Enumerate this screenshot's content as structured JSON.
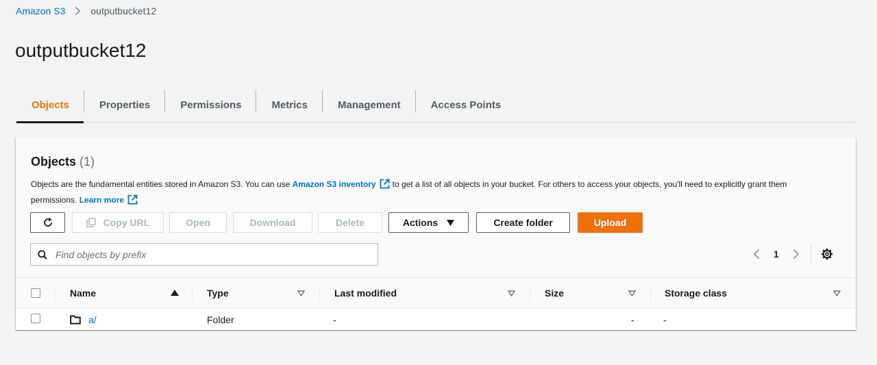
{
  "breadcrumb": {
    "root": "Amazon S3",
    "current": "outputbucket12"
  },
  "page_title": "outputbucket12",
  "tabs": [
    {
      "label": "Objects",
      "active": true
    },
    {
      "label": "Properties",
      "active": false
    },
    {
      "label": "Permissions",
      "active": false
    },
    {
      "label": "Metrics",
      "active": false
    },
    {
      "label": "Management",
      "active": false
    },
    {
      "label": "Access Points",
      "active": false
    }
  ],
  "objects_panel": {
    "title": "Objects",
    "count": "(1)",
    "desc_part1": "Objects are the fundamental entities stored in Amazon S3. You can use",
    "inventory_link": "Amazon S3 inventory",
    "desc_part2": "to get a list of all objects in your bucket. For others to access your objects, you'll need to explicitly grant them permissions.",
    "learn_more": "Learn more"
  },
  "toolbar": {
    "copy_url": "Copy URL",
    "open": "Open",
    "download": "Download",
    "delete": "Delete",
    "actions": "Actions",
    "create_folder": "Create folder",
    "upload": "Upload"
  },
  "search": {
    "placeholder": "Find objects by prefix",
    "value": ""
  },
  "pagination": {
    "current_page": "1"
  },
  "table": {
    "columns": [
      "Name",
      "Type",
      "Last modified",
      "Size",
      "Storage class"
    ],
    "rows": [
      {
        "name": "a/",
        "type": "Folder",
        "last_modified": "-",
        "size": "-",
        "storage_class": "-"
      }
    ]
  },
  "colors": {
    "accent": "#ec7211",
    "link": "#0073bb",
    "text": "#16191f",
    "background": "#f2f3f3"
  },
  "icons": [
    "chevron-right-icon",
    "external-link-icon",
    "refresh-icon",
    "copy-icon",
    "caret-down-icon",
    "search-icon",
    "chevron-left-icon",
    "gear-icon",
    "sort-asc-icon",
    "sort-icon",
    "folder-icon"
  ]
}
